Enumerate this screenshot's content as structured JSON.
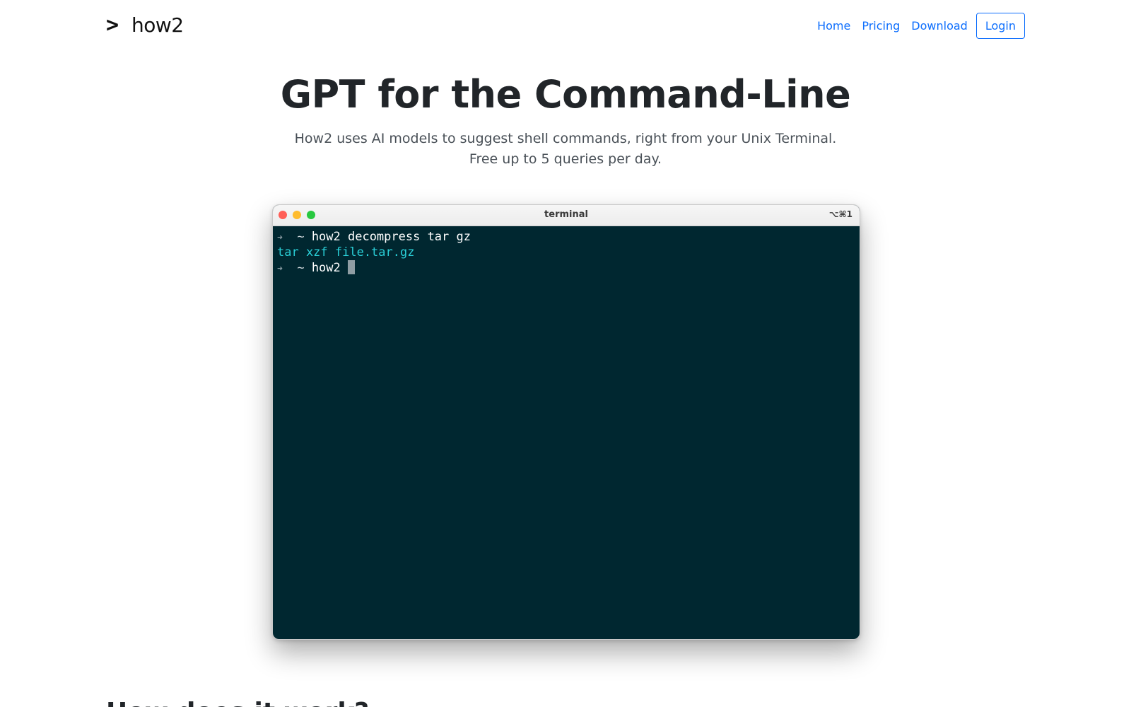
{
  "nav": {
    "brand_icon": ">",
    "brand_name": "how2",
    "links": [
      "Home",
      "Pricing",
      "Download"
    ],
    "login_label": "Login"
  },
  "hero": {
    "title": "GPT for the Command-Line",
    "subtitle_line1": "How2 uses AI models to suggest shell commands, right from your Unix Terminal.",
    "subtitle_line2": "Free up to 5 queries per day."
  },
  "terminal": {
    "title": "terminal",
    "shortcut": "⌥⌘1",
    "window_colors": {
      "close": "#ff5f57",
      "minimize": "#febc2e",
      "maximize": "#28c840"
    },
    "background_color": "#002730",
    "output_color": "#2ad0d8",
    "lines": [
      {
        "arrow": "➜",
        "tilde": "~",
        "command": "how2 decompress tar gz"
      },
      {
        "output": "tar xzf file.tar.gz"
      },
      {
        "arrow": "➜",
        "tilde": "~",
        "command": "how2"
      }
    ]
  },
  "section": {
    "heading": "How does it work?"
  },
  "colors": {
    "link": "#0d6efd",
    "heading": "#212529",
    "subtext": "#495057"
  }
}
